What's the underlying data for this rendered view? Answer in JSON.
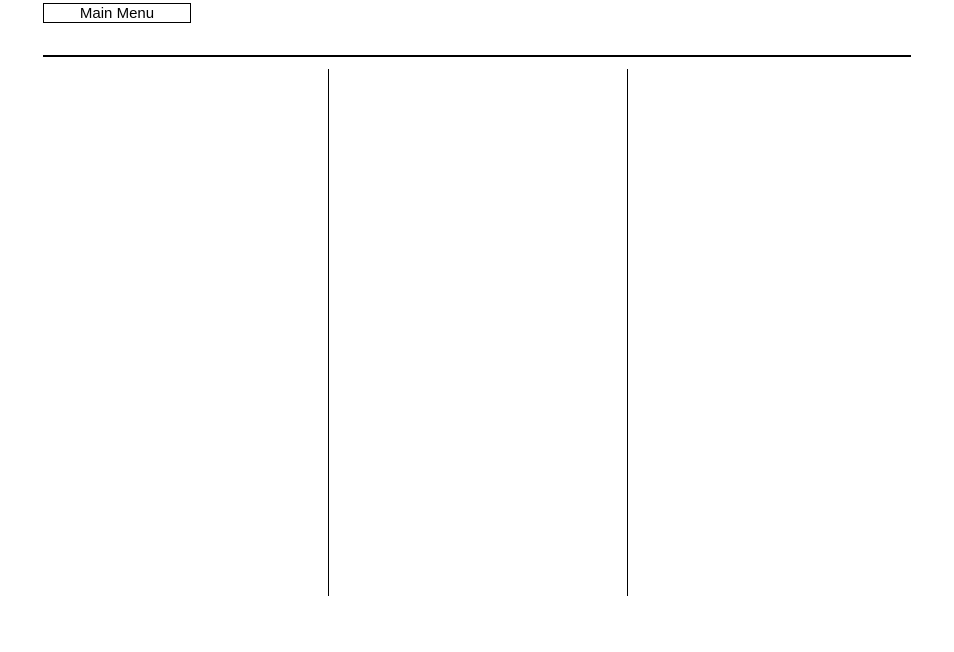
{
  "header": {
    "main_menu_label": "Main Menu"
  }
}
